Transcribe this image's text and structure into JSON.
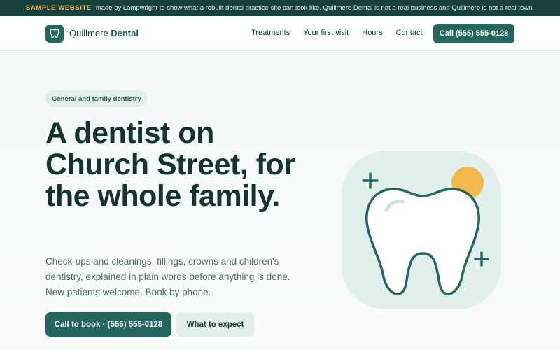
{
  "banner": {
    "tag": "SAMPLE WEBSITE",
    "text": "made by Lampwright to show what a rebuilt dental practice site can look like. Quillmere Dental is not a real business and Quillmere is not a real town."
  },
  "brand": {
    "name_light": "Quillmere",
    "name_bold": "Dental",
    "icon": "tooth-icon"
  },
  "nav": {
    "links": [
      "Treatments",
      "Your first visit",
      "Hours",
      "Contact"
    ],
    "call_label": "Call (555) 555-0128"
  },
  "hero": {
    "pill": "General and family dentistry",
    "headline": "A dentist on Church Street, for the whole family.",
    "lede": "Check-ups and cleanings, fillings, crowns and children's dentistry, explained in plain words before anything is done. New patients welcome. Book by phone.",
    "primary_button": "Call to book · (555) 555-0128",
    "secondary_button": "What to expect"
  },
  "colors": {
    "brand": "#23675f",
    "dark": "#17403b",
    "accent": "#f2b84b",
    "soft": "#e2f0eb"
  }
}
